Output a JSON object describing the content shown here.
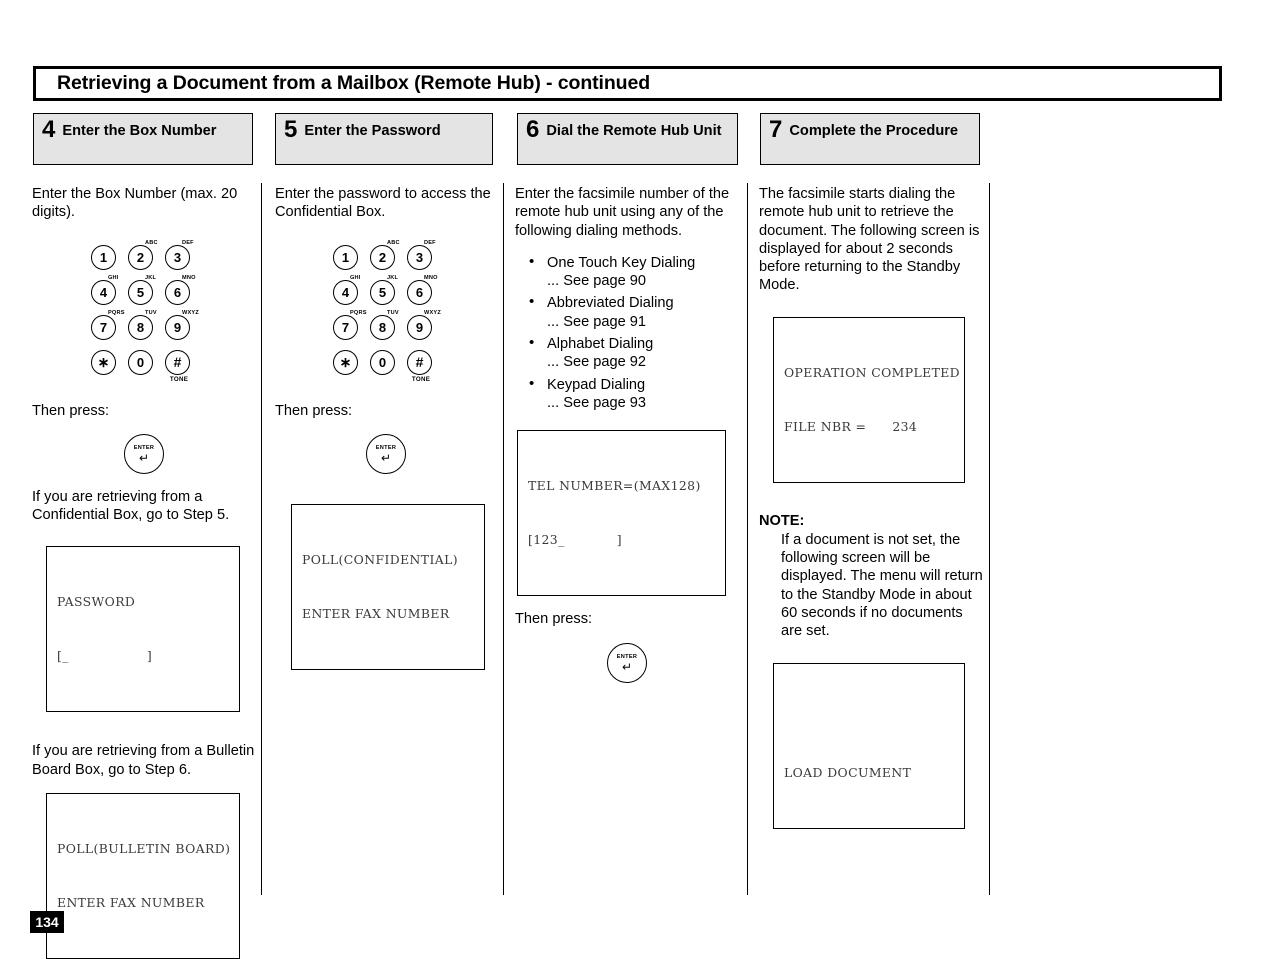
{
  "document": {
    "title": "Retrieving a Document from a Mailbox (Remote Hub) - continued",
    "page_number": "134"
  },
  "keypad": {
    "keys": [
      {
        "label": "1",
        "letters": ""
      },
      {
        "label": "2",
        "letters": "ABC"
      },
      {
        "label": "3",
        "letters": "DEF"
      },
      {
        "label": "4",
        "letters": "GHI"
      },
      {
        "label": "5",
        "letters": "JKL"
      },
      {
        "label": "6",
        "letters": "MNO"
      },
      {
        "label": "7",
        "letters": "PQRS"
      },
      {
        "label": "8",
        "letters": "TUV"
      },
      {
        "label": "9",
        "letters": "WXYZ"
      },
      {
        "label": "∗",
        "letters": ""
      },
      {
        "label": "0",
        "letters": ""
      },
      {
        "label": "#",
        "letters": ""
      }
    ],
    "tone_label": "TONE"
  },
  "enter_button": {
    "label": "ENTER",
    "arrow": "↵"
  },
  "steps": [
    {
      "number": "4",
      "title": "Enter the Box Number",
      "intro": "Enter the Box Number (max. 20 digits).",
      "then_press": "Then press:",
      "text_confidential": "If you are retrieving from a Confidential Box, go to Step 5.",
      "lcd_password": {
        "line1": "PASSWORD",
        "line2": "[_                  ]"
      },
      "text_bulletin": "If you are retrieving from a Bulletin Board Box, go to Step 6.",
      "lcd_bulletin": {
        "line1": "POLL(BULLETIN BOARD)",
        "line2": "ENTER FAX NUMBER"
      }
    },
    {
      "number": "5",
      "title": "Enter the Password",
      "intro": "Enter the password to access the Confidential Box.",
      "then_press": "Then press:",
      "lcd_poll": {
        "line1": "POLL(CONFIDENTIAL)",
        "line2": "ENTER FAX NUMBER"
      }
    },
    {
      "number": "6",
      "title": "Dial the Remote Hub Unit",
      "intro": "Enter the facsimile number of the remote hub unit using any of the following dialing methods.",
      "dialing_methods": [
        {
          "name": "One Touch Key Dialing",
          "reference": "... See page 90"
        },
        {
          "name": "Abbreviated Dialing",
          "reference": "... See page 91"
        },
        {
          "name": "Alphabet Dialing",
          "reference": "... See page 92"
        },
        {
          "name": "Keypad Dialing",
          "reference": "... See page 93"
        }
      ],
      "lcd_tel": {
        "line1": "TEL NUMBER=(MAX128)",
        "line2": "[123_            ]"
      },
      "then_press": "Then press:"
    },
    {
      "number": "7",
      "title": "Complete the Procedure",
      "intro": "The facsimile starts dialing the remote hub unit to retrieve the document. The following screen is displayed for about 2 seconds before returning to the Standby Mode.",
      "lcd_completed": {
        "line1": "OPERATION COMPLETED",
        "line2": "FILE NBR =      234"
      },
      "note_label": "NOTE:",
      "note_text": "If a document is not set, the following screen will be displayed. The menu will return to the Standby Mode in about 60 seconds if no documents are set.",
      "lcd_load": {
        "line1": "",
        "line2": "LOAD DOCUMENT"
      }
    }
  ]
}
